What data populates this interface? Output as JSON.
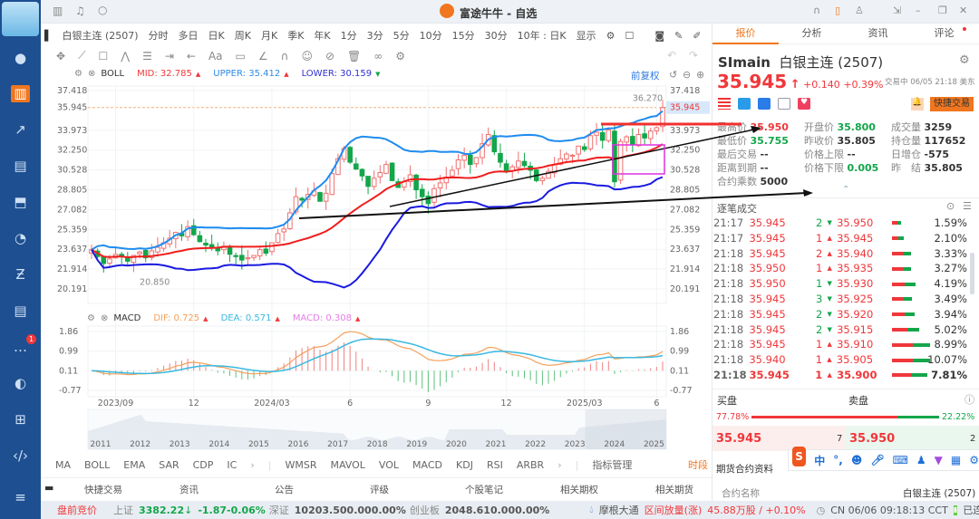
{
  "app": {
    "title": "富途牛牛 - 自选",
    "badge_count": "1"
  },
  "toolbar": {
    "symbol": "白银主连 (2507)",
    "periods": [
      "分时",
      "多日",
      "日K",
      "周K",
      "月K",
      "季K",
      "年K",
      "1分",
      "3分",
      "5分",
      "10分",
      "15分",
      "30分"
    ],
    "active_period": "周K",
    "range": "10年 : 日K",
    "display": "显示"
  },
  "boll": {
    "name": "BOLL",
    "mid_label": "MID:",
    "mid": "32.785",
    "upper_label": "UPPER:",
    "upper": "35.412",
    "lower_label": "LOWER:",
    "lower": "30.159",
    "adjust": "前复权"
  },
  "price_axis": [
    "37.418",
    "35.945",
    "33.973",
    "32.250",
    "30.528",
    "28.805",
    "27.082",
    "25.359",
    "23.637",
    "21.914",
    "20.191"
  ],
  "chart_annotations": {
    "high": "36.270",
    "low": "20.850",
    "last": "35.945"
  },
  "macd": {
    "name": "MACD",
    "dif_label": "DIF:",
    "dif": "0.725",
    "dea_label": "DEA:",
    "dea": "0.571",
    "macd_label": "MACD:",
    "macd": "0.308",
    "axis": [
      "1.86",
      "0.99",
      "0.11",
      "-0.77"
    ]
  },
  "date_axis": [
    "2023/09",
    "12",
    "2024/03",
    "6",
    "9",
    "12",
    "2025/03",
    "6"
  ],
  "navigator_years": [
    "2011",
    "2012",
    "2013",
    "2014",
    "2015",
    "2016",
    "2017",
    "2018",
    "2019",
    "2020",
    "2021",
    "2022",
    "2023",
    "2024",
    "2025"
  ],
  "chart_data": {
    "type": "candlestick",
    "title": "白银主连 (2507) 周K",
    "weekly_closes": [
      23.6,
      23.0,
      22.4,
      22.8,
      23.2,
      23.0,
      22.6,
      23.1,
      23.4,
      22.9,
      23.5,
      23.8,
      24.2,
      24.6,
      25.1,
      24.8,
      25.6,
      24.9,
      24.3,
      24.0,
      23.8,
      23.5,
      23.9,
      23.2,
      23.0,
      22.7,
      22.9,
      23.1,
      23.6,
      23.3,
      24.2,
      25.0,
      25.4,
      26.8,
      28.2,
      27.9,
      28.4,
      28.7,
      27.8,
      28.5,
      30.2,
      31.5,
      32.4,
      31.2,
      30.6,
      30.0,
      29.1,
      29.8,
      30.3,
      31.0,
      29.6,
      29.0,
      29.5,
      30.1,
      28.8,
      28.2,
      27.6,
      28.9,
      29.4,
      29.9,
      30.5,
      31.4,
      31.8,
      31.0,
      31.6,
      32.8,
      33.6,
      32.1,
      31.2,
      30.4,
      30.8,
      31.3,
      30.9,
      30.5,
      29.6,
      29.8,
      30.4,
      31.0,
      31.5,
      31.9,
      31.8,
      32.6,
      32.3,
      33.5,
      33.8,
      33.1,
      34.0,
      29.5,
      33.0,
      33.4,
      32.7,
      33.6,
      33.3,
      33.9,
      34.2,
      35.945
    ],
    "ylim": [
      20.191,
      37.418
    ],
    "macd_ylim": [
      -0.77,
      1.86
    ]
  },
  "indicators": {
    "main": [
      "MA",
      "BOLL",
      "EMA",
      "SAR",
      "CDP",
      "IC"
    ],
    "sub": [
      "WMSR",
      "MAVOL",
      "VOL",
      "MACD",
      "KDJ",
      "RSI",
      "ARBR"
    ],
    "manage": "指标管理",
    "period": "时段"
  },
  "bottom_tabs": [
    "快捷交易",
    "资讯",
    "公告",
    "评级",
    "个股笔记",
    "相关期权",
    "相关期货"
  ],
  "quote": {
    "tabs": [
      "报价",
      "分析",
      "资讯",
      "评论"
    ],
    "code": "SImain",
    "name": "白银主连 (2507)",
    "price": "35.945",
    "change": "+0.140",
    "change_pct": "+0.39%",
    "status": "交易中 06/05 21:18 美东",
    "quick_trade": "快捷交易",
    "fields": [
      [
        "最高价",
        "35.950",
        "开盘价",
        "35.800",
        "成交量",
        "3259"
      ],
      [
        "最低价",
        "35.755",
        "昨收价",
        "35.805",
        "持仓量",
        "117652"
      ],
      [
        "最后交易",
        "--",
        "价格上限",
        "--",
        "日增仓",
        "-575"
      ],
      [
        "距离到期",
        "--",
        "价格下限",
        "0.005",
        "昨　结",
        "35.805"
      ],
      [
        "合约乘数",
        "5000"
      ]
    ]
  },
  "trades": {
    "title": "逐笔成交",
    "rows": [
      [
        "21:17",
        "35.945",
        "2",
        "down",
        "35.950",
        "1.59%",
        0.4
      ],
      [
        "21:17",
        "35.945",
        "1",
        "up",
        "35.945",
        "2.10%",
        0.5
      ],
      [
        "21:18",
        "35.945",
        "2",
        "up",
        "35.940",
        "3.33%",
        0.8
      ],
      [
        "21:18",
        "35.950",
        "1",
        "up",
        "35.935",
        "3.27%",
        0.8
      ],
      [
        "21:18",
        "35.950",
        "1",
        "down",
        "35.930",
        "4.19%",
        1.0
      ],
      [
        "21:18",
        "35.945",
        "3",
        "down",
        "35.925",
        "3.49%",
        0.85
      ],
      [
        "21:18",
        "35.945",
        "2",
        "down",
        "35.920",
        "3.94%",
        0.95
      ],
      [
        "21:18",
        "35.945",
        "2",
        "down",
        "35.915",
        "5.02%",
        1.15
      ],
      [
        "21:18",
        "35.945",
        "1",
        "up",
        "35.910",
        "8.99%",
        1.6
      ],
      [
        "21:18",
        "35.940",
        "1",
        "up",
        "35.905",
        "10.07%",
        1.6
      ],
      [
        "21:18",
        "35.945",
        "1",
        "up",
        "35.900",
        "7.81%",
        1.5
      ]
    ]
  },
  "orderbook": {
    "bid_label": "买盘",
    "ask_label": "卖盘",
    "bid_pct": "77.78%",
    "ask_pct": "22.22%",
    "bid_ratio": 0.7778,
    "bid": "35.945",
    "bid_qty": "7",
    "ask": "35.950",
    "ask_qty": "2"
  },
  "contract": {
    "title": "期货合约资料",
    "name_label": "合约名称",
    "name": "白银主连 (2507)"
  },
  "statusbar": {
    "market": "盘前竞价",
    "sh_label": "上证",
    "sh": "3382.22",
    "sh_chg": "-1.87",
    "sh_pct": "-0.06%",
    "sz_label": "深证",
    "sz": "10203.50",
    "sz_chg": "0.00",
    "sz_pct": "0.00%",
    "cy_label": "创业板",
    "cy": "2048.61",
    "cy_chg": "0.00",
    "cy_pct": "0.00%",
    "mg": "摩根大通",
    "flow": "区间放量(涨)",
    "flow_val": "45.88万股 / +0.10%",
    "time": "CN 06/06 09:18:13 CCT",
    "conn": "已连接"
  },
  "ime": {
    "lang": "中",
    "punct": "°,"
  }
}
